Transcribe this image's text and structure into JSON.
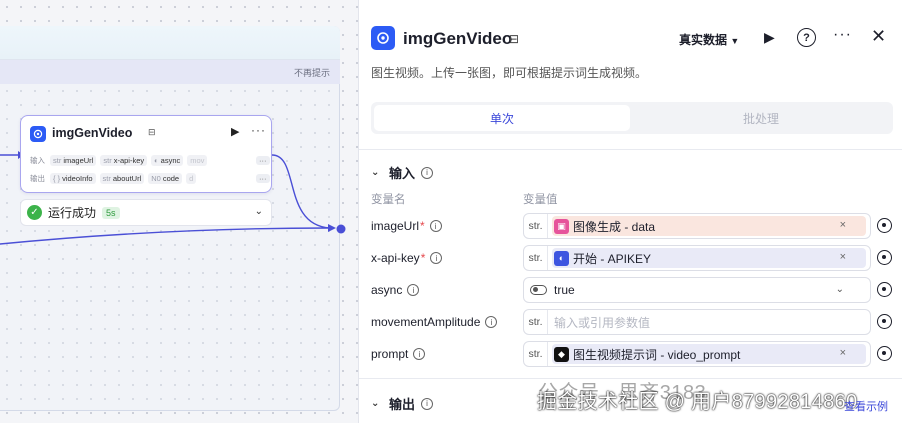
{
  "canvas": {
    "notice_close": "不再提示",
    "node": {
      "title": "imgGenVideo",
      "input_label": "输入",
      "output_label": "输出",
      "inputs": [
        {
          "type": "str",
          "name": "imageUrl"
        },
        {
          "type": "str",
          "name": "x-api-key"
        },
        {
          "type": "",
          "name": "async"
        },
        {
          "type": "",
          "name": "mov"
        }
      ],
      "outputs": [
        {
          "type": "{ }",
          "name": "videoInfo"
        },
        {
          "type": "str",
          "name": "aboutUrl"
        },
        {
          "type": "N0",
          "name": "code"
        },
        {
          "type": "",
          "name": "d"
        }
      ],
      "more_label": "···"
    },
    "run_status": {
      "text": "运行成功",
      "time": "5s"
    }
  },
  "panel": {
    "title": "imgGenVideo",
    "data_mode": "真实数据",
    "description": "图生视频。上传一张图，即可根据提示词生成视频。",
    "tabs": [
      "单次",
      "批处理"
    ],
    "input_section": "输入",
    "output_section": "输出",
    "col_var_name": "变量名",
    "col_var_value": "变量值",
    "params": [
      {
        "name": "imageUrl",
        "required": true,
        "kind": "ref",
        "type": "str.",
        "chip_color": "orange",
        "icon_color": "#e6549b",
        "value": "图像生成 - data"
      },
      {
        "name": "x-api-key",
        "required": true,
        "kind": "ref",
        "type": "str.",
        "chip_color": "lilac",
        "icon_color": "#3d55e0",
        "value": "开始 - APIKEY"
      },
      {
        "name": "async",
        "required": false,
        "kind": "select",
        "value": "true"
      },
      {
        "name": "movementAmplitude",
        "required": false,
        "kind": "input",
        "type": "str.",
        "placeholder": "输入或引用参数值"
      },
      {
        "name": "prompt",
        "required": false,
        "kind": "ref",
        "type": "str.",
        "chip_color": "lilac",
        "icon_color": "#111111",
        "value": "图生视频提示词 - video_prompt"
      }
    ],
    "footer_link": "查看示例"
  },
  "watermark": {
    "line1": "公众号 · 思齐3183",
    "line2": "掘金技术社区 @ 用户87992814860"
  },
  "colors": {
    "accent": "#3b47d9",
    "brand_blue": "#2c5bf5",
    "success": "#3cb34a",
    "node_border": "#a9a6ef",
    "edge": "#4a4fd6"
  }
}
